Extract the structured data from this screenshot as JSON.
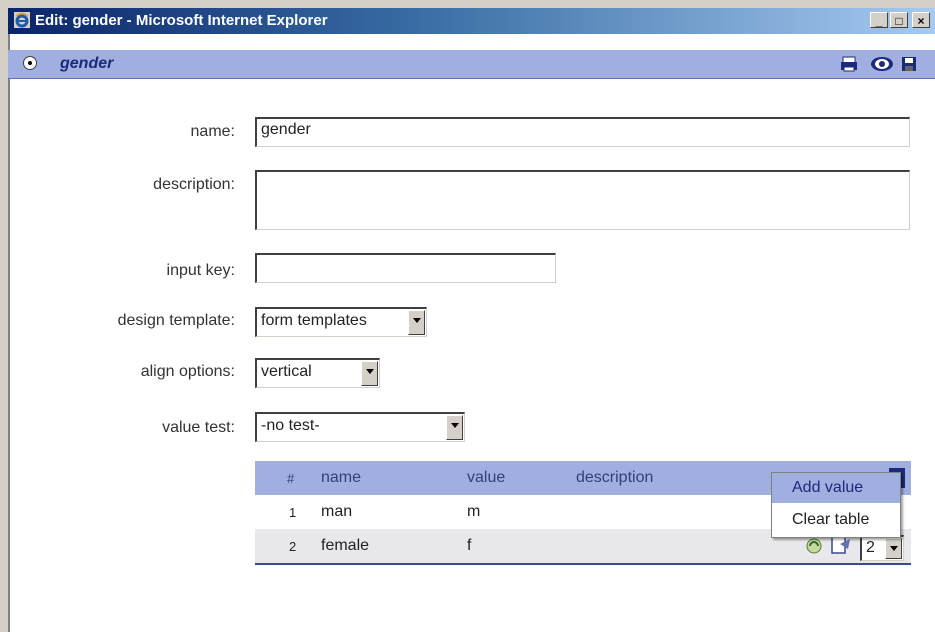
{
  "window": {
    "title": "Edit: gender - Microsoft Internet Explorer"
  },
  "window_buttons": {
    "minimize": "_",
    "maximize": "□",
    "close": "×"
  },
  "subbar": {
    "title": "gender",
    "icons": [
      "printer-icon",
      "preview-eye-icon",
      "save-disk-icon"
    ]
  },
  "form": {
    "name_label": "name:",
    "name_value": "gender",
    "description_label": "description:",
    "description_value": "",
    "input_key_label": "input key:",
    "input_key_value": "",
    "design_template_label": "design template:",
    "design_template_value": "form templates",
    "align_options_label": "align options:",
    "align_options_value": "vertical",
    "value_test_label": "value test:",
    "value_test_value": "-no test-"
  },
  "table": {
    "headers": {
      "num": "#",
      "name": "name",
      "value": "value",
      "description": "description"
    },
    "rows": [
      {
        "num": "1",
        "name": "man",
        "value": "m",
        "description": ""
      },
      {
        "num": "2",
        "name": "female",
        "value": "f",
        "description": "",
        "order": "2"
      }
    ]
  },
  "context_menu": {
    "items": [
      "Add value",
      "Clear table"
    ]
  },
  "colors": {
    "accent": "#a0aee0",
    "title_gradient_start": "#0a246a",
    "title_text": "#1b2a7a"
  }
}
